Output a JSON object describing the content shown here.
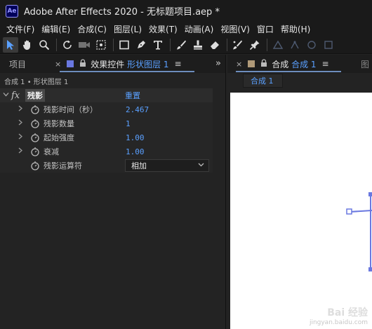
{
  "window": {
    "app_icon": "Ae",
    "title": "Adobe After Effects 2020 - 无标题项目.aep *"
  },
  "menu": [
    {
      "label": "文件(F)"
    },
    {
      "label": "编辑(E)"
    },
    {
      "label": "合成(C)"
    },
    {
      "label": "图层(L)"
    },
    {
      "label": "效果(T)"
    },
    {
      "label": "动画(A)"
    },
    {
      "label": "视图(V)"
    },
    {
      "label": "窗口"
    },
    {
      "label": "帮助(H)"
    }
  ],
  "toolbar": {
    "tools": [
      "selection-tool",
      "hand-tool",
      "zoom-tool",
      "rotate-tool",
      "camera-tool",
      "pan-behind-tool",
      "rectangle-tool",
      "pen-tool",
      "type-tool",
      "brush-tool",
      "clone-stamp-tool",
      "eraser-tool",
      "roto-brush-tool",
      "puppet-pin-tool"
    ]
  },
  "left_panel": {
    "project_tab": "项目",
    "close_glyph": "×",
    "effects_tab_prefix": "效果控件",
    "effects_tab_layer": "形状图层 1",
    "menu_glyph": "≡",
    "expand_glyph": "»",
    "swatch_color": "#6a78e0",
    "breadcrumb": "合成 1 • 形状图层 1",
    "effect": {
      "fx": "fx",
      "name": "残影",
      "reset": "重置"
    },
    "properties": [
      {
        "label": "残影时间（秒）",
        "value": "2.467"
      },
      {
        "label": "残影数量",
        "value": "1"
      },
      {
        "label": "起始强度",
        "value": "1.00"
      },
      {
        "label": "衰减",
        "value": "1.00"
      }
    ],
    "operator": {
      "label": "残影运算符",
      "value": "相加"
    }
  },
  "right_panel": {
    "close_glyph": "×",
    "swatch_color": "#b09a78",
    "tab_prefix": "合成",
    "tab_comp": "合成 1",
    "menu_glyph": "≡",
    "edge_tab": "图",
    "subtab": "合成 1"
  },
  "watermark": {
    "main": "Bai 经验",
    "sub": "jingyan.baidu.com"
  }
}
